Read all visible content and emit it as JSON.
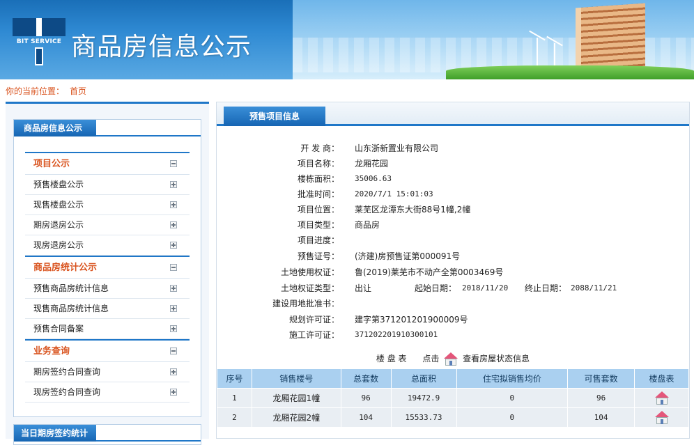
{
  "header": {
    "logo_text": "BIT SERVICE",
    "title": "商品房信息公示"
  },
  "breadcrumb": {
    "label": "你的当前位置：",
    "home": "首页"
  },
  "sidebar": {
    "box_title": "商品房信息公示",
    "groups": [
      {
        "label": "项目公示",
        "items": [
          "预售楼盘公示",
          "现售楼盘公示",
          "期房退房公示",
          "现房退房公示"
        ]
      },
      {
        "label": "商品房统计公示",
        "items": [
          "预售商品房统计信息",
          "现售商品房统计信息",
          "预售合同备案"
        ]
      },
      {
        "label": "业务查询",
        "items": [
          "期房签约合同查询",
          "现房签约合同查询"
        ]
      }
    ],
    "box2_title": "当日期房签约统计"
  },
  "main": {
    "tab": "预售项目信息",
    "fields": {
      "developer_label": "开 发 商：",
      "developer": "山东浙新置业有限公司",
      "project_name_label": "项目名称：",
      "project_name": "龙厢花园",
      "building_area_label": "楼栋面积：",
      "building_area": "35006.63",
      "approve_time_label": "批准时间：",
      "approve_time": "2020/7/1 15:01:03",
      "location_label": "项目位置：",
      "location": "莱芜区龙潭东大街88号1幢,2幢",
      "type_label": "项目类型：",
      "type": "商品房",
      "progress_label": "项目进度：",
      "progress": "",
      "presale_cert_label": "预售证号：",
      "presale_cert": "(济建)房预售证第000091号",
      "land_right_label": "土地使用权证：",
      "land_right": "鲁(2019)莱芜市不动产全第0003469号",
      "land_type_label": "土地权证类型：",
      "land_type": "出让",
      "start_date_label": "起始日期：",
      "start_date": "2018/11/20",
      "end_date_label": "终止日期：",
      "end_date": "2088/11/21",
      "land_approval_label": "建设用地批准书：",
      "land_approval": "",
      "plan_permit_label": "规划许可证：",
      "plan_permit": "建字第371201201900009号",
      "construction_permit_label": "施工许可证：",
      "construction_permit": "371202201910300101"
    },
    "lp_prefix": "楼 盘 表",
    "lp_click": "点击",
    "lp_suffix": "查看房屋状态信息",
    "table": {
      "headers": [
        "序号",
        "销售楼号",
        "总套数",
        "总面积",
        "住宅拟销售均价",
        "可售套数",
        "楼盘表"
      ],
      "rows": [
        [
          "1",
          "龙厢花园1幢",
          "96",
          "19472.9",
          "0",
          "96"
        ],
        [
          "2",
          "龙厢花园2幢",
          "104",
          "15533.73",
          "0",
          "104"
        ]
      ]
    }
  }
}
